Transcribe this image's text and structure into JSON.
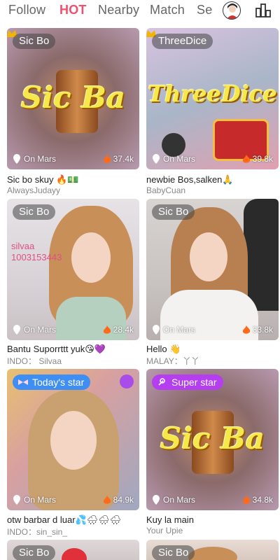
{
  "tabs": {
    "follow": "Follow",
    "hot": "HOT",
    "nearby": "Nearby",
    "match": "Match",
    "se": "Se"
  },
  "icons": {
    "avatar": "avatar-icon",
    "rank": "ranking-icon"
  },
  "colors": {
    "active_tab": "#f0506e",
    "todays_star_tag": "#3f8ef3",
    "super_star_tag": "#b43ef0"
  },
  "cards": [
    {
      "tag": "Sic Bo",
      "location": "On Mars",
      "views": "37.4k",
      "title": "Sic bo skuy 🔥💵",
      "user": "AlwaysJudayy",
      "banner": "Sic Ba"
    },
    {
      "tag": "ThreeDice",
      "location": "On Mars",
      "views": "39.8k",
      "title": "newbie Bos,salken🙏",
      "user": "BabyCuan",
      "banner": "ThreeDice"
    },
    {
      "tag": "Sic Bo",
      "location": "On Mars",
      "views": "28.4k",
      "title": "Bantu Suporrttt yuk😘💜",
      "user": "INDO： Silvaa",
      "overlay": "silvaa\n1003153443"
    },
    {
      "tag": "Sic Bo",
      "location": "On Mars",
      "views": "33.8k",
      "title": "Hello 👋",
      "user": "MALAY：丫丫"
    },
    {
      "tag": "Today's star",
      "location": "On Mars",
      "views": "84.9k",
      "title": "otw barbar d luar💦🌧🌧🌧",
      "user": "INDO：sin_sin_"
    },
    {
      "tag": "Super star",
      "location": "On Mars",
      "views": "34.8k",
      "title": "Kuy la main",
      "user": "Your Upie",
      "banner": "Sic Ba"
    },
    {
      "tag": "Sic Bo"
    },
    {
      "tag": "Sic Bo"
    }
  ]
}
